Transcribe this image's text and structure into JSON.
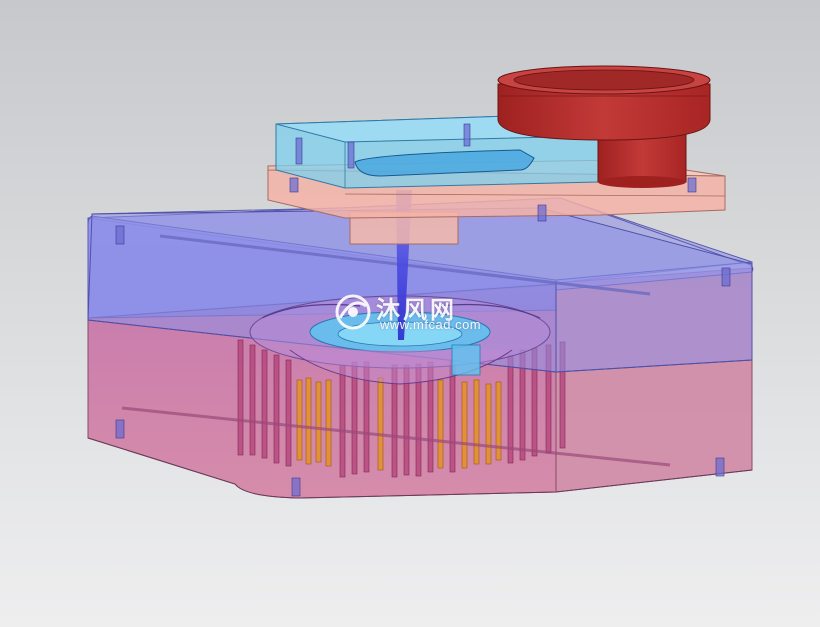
{
  "watermark": {
    "brand_cn": "沐风网",
    "url": "www.mfcad.com"
  },
  "colors": {
    "background_top": "#c6c8cb",
    "background_bottom": "#eeeeef",
    "upper_mold_plate": "#7b7fe6",
    "lower_mold_plate": "#d4709a",
    "top_clamp_plate": "#f5b3a8",
    "runner_plate": "#7ed0ee",
    "locating_ring": "#b82f2e",
    "sprue": "#3a3ad8",
    "ejector_pins": "#e3922c",
    "part_cavity": "#5ec4f0"
  },
  "icons": [
    "mfcad-logo-icon"
  ]
}
